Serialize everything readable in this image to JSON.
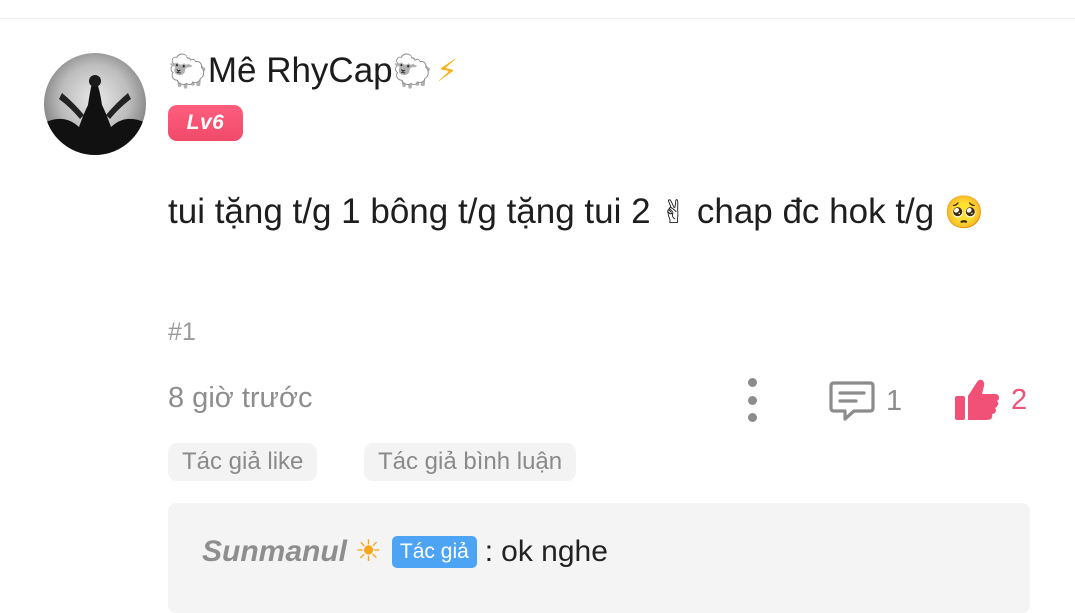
{
  "comment": {
    "username_prefix_emoji": "🐑",
    "username": "Mê RhyCap",
    "username_suffix_emoji": "🐑",
    "username_bolt_emoji": "⚡",
    "level": "Lv6",
    "text_part1": "tui tặng t/g 1 bông t/g tặng tui 2 ",
    "emoji_victory": "✌",
    "text_part2": " chap đc hok t/g ",
    "emoji_pleading": "🥺",
    "floor": "#1",
    "time": "8 giờ trước",
    "reply_count": "1",
    "like_count": "2",
    "like_color": "#f25177"
  },
  "tags": [
    "Tác giả like",
    "Tác giả bình luận"
  ],
  "reply": {
    "user": "Sunmanul",
    "user_emoji": "☀",
    "author_badge": "Tác giả",
    "separator": ":",
    "text": "ok nghe"
  },
  "icons": {
    "more": "more-vertical-icon",
    "reply": "comment-icon",
    "like": "thumbs-up-icon"
  }
}
